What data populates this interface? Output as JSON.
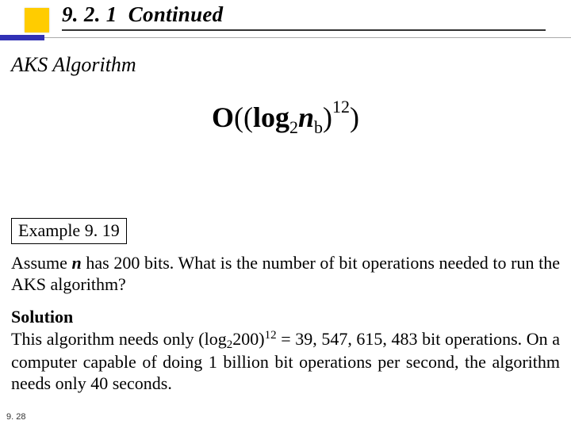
{
  "header": {
    "section_number": "9. 2. 1",
    "section_word": "Continued"
  },
  "subheading": "AKS Algorithm",
  "formula": {
    "raw": "O((log2 n_b)^12)",
    "bigO": "O",
    "open": "((",
    "log": "log",
    "logbase": "2",
    "var": "n",
    "varsub": "b",
    "close_inner": ")",
    "exponent": "12",
    "close_outer": ")"
  },
  "example": {
    "label": "Example 9. 19",
    "question_pre": "Assume ",
    "question_var": "n",
    "question_post": " has 200 bits. What is the number of bit operations needed to run the AKS algorithm?",
    "solution_label": "Solution",
    "solution_pre": "This algorithm needs only (log",
    "solution_base": "2",
    "solution_arg": "200)",
    "solution_exp": "12",
    "solution_post": " = 39, 547, 615, 483 bit operations. On a computer capable of doing 1 billion bit operations per second, the algorithm needs only 40 seconds."
  },
  "page_number": "9. 28"
}
